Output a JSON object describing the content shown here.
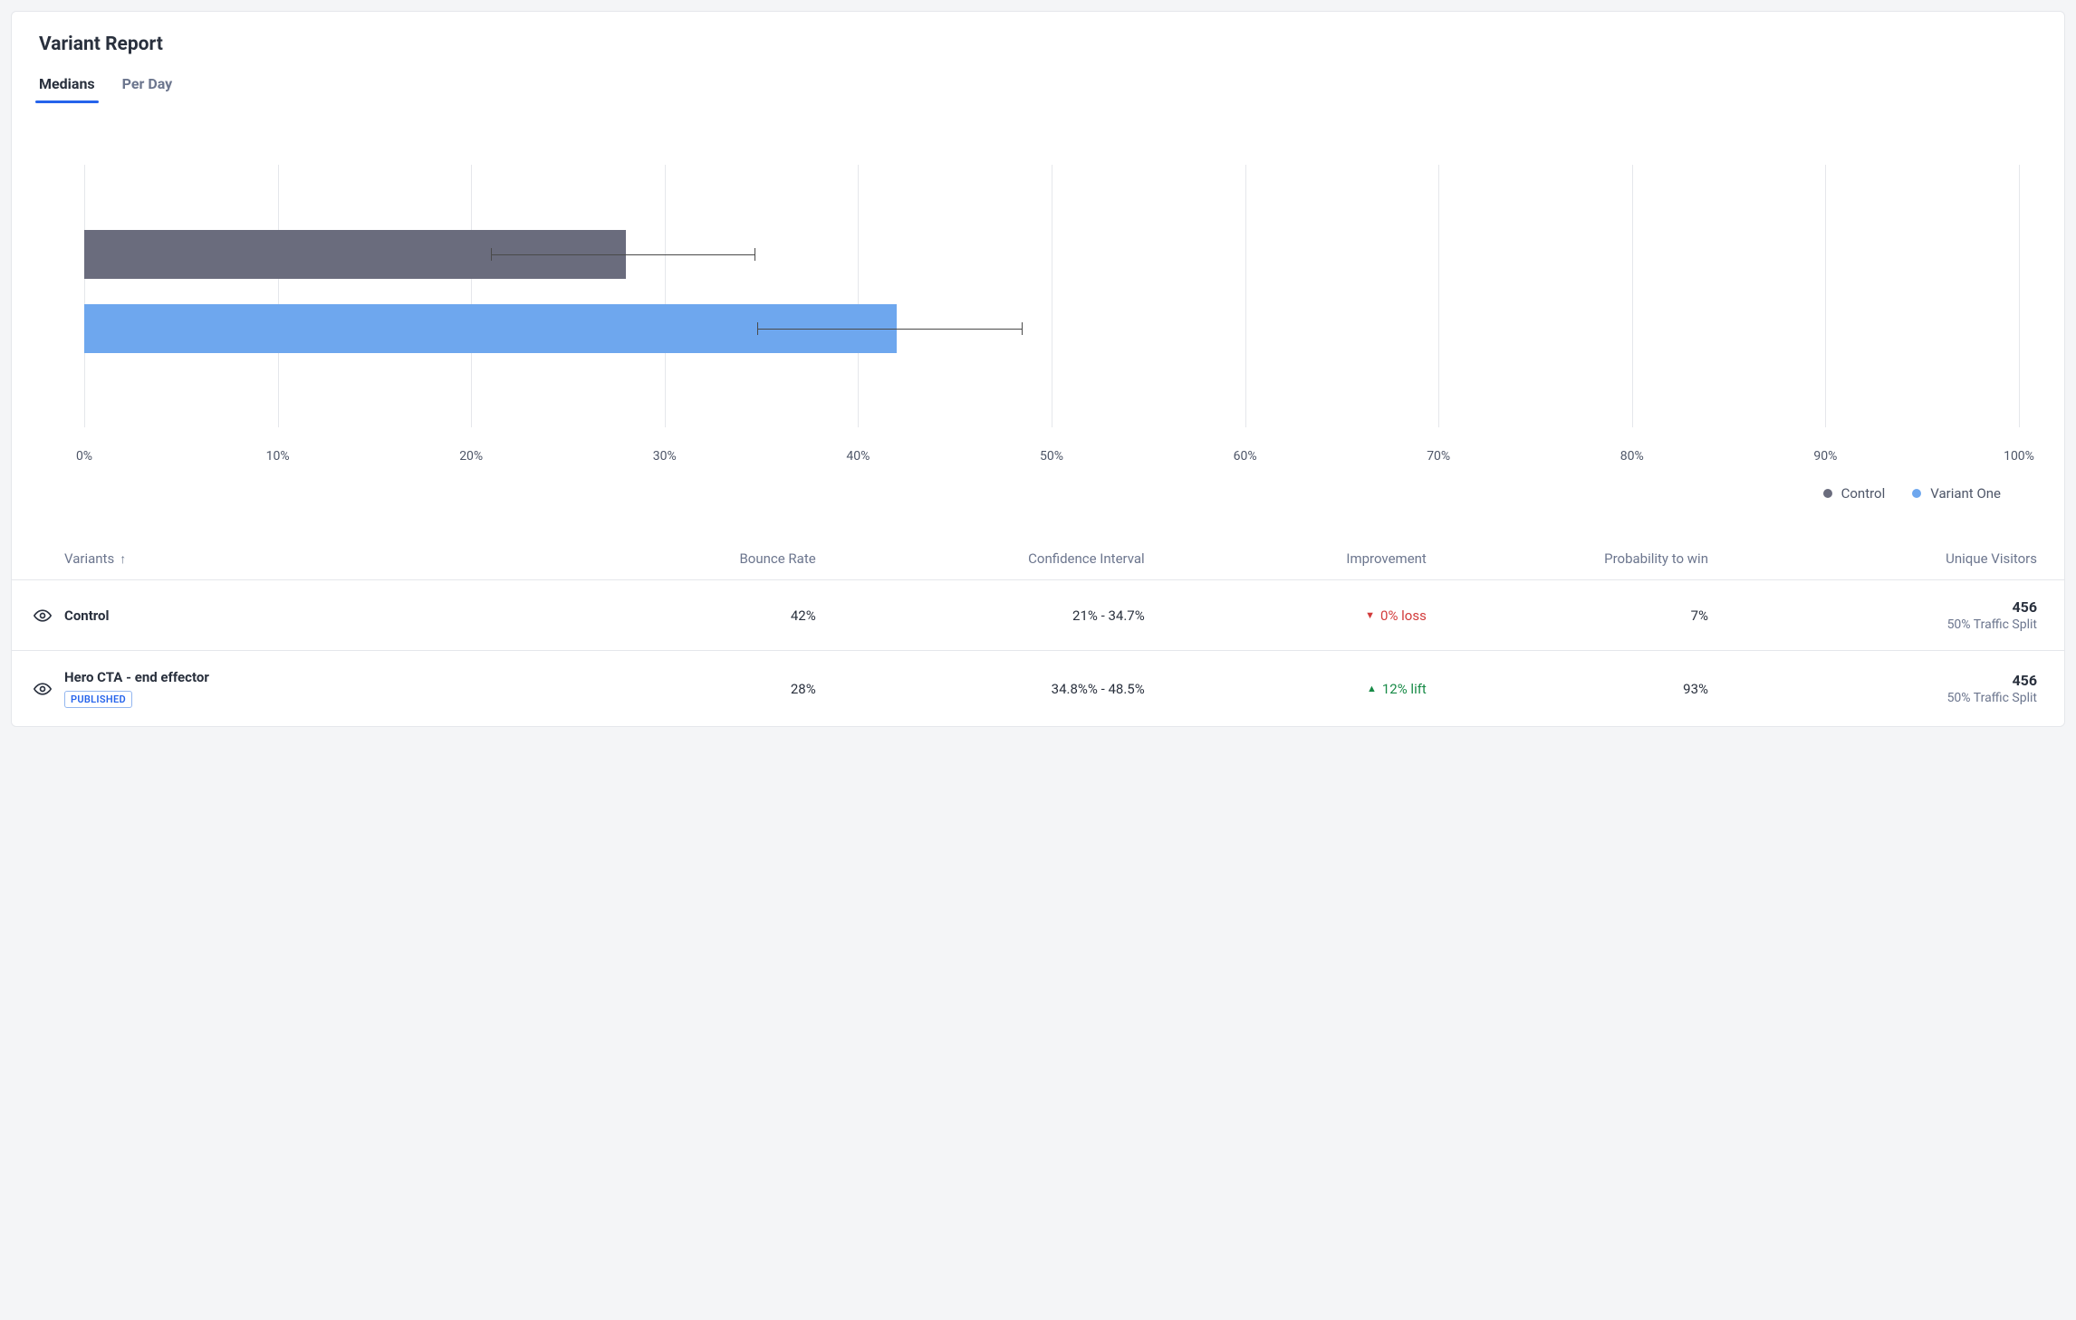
{
  "title": "Variant Report",
  "tabs": {
    "medians": "Medians",
    "per_day": "Per Day",
    "active": "medians"
  },
  "chart_data": {
    "type": "bar",
    "orientation": "horizontal",
    "xlabel": "",
    "ylabel": "",
    "xlim": [
      0,
      100
    ],
    "x_unit": "%",
    "ticks": [
      "0%",
      "10%",
      "20%",
      "30%",
      "40%",
      "50%",
      "60%",
      "70%",
      "80%",
      "90%",
      "100%"
    ],
    "series": [
      {
        "name": "Control",
        "color": "#6a6c7d",
        "value": 28,
        "error_low": 21.0,
        "error_high": 34.7
      },
      {
        "name": "Variant One",
        "color": "#6ea7ee",
        "value": 42,
        "error_low": 34.8,
        "error_high": 48.5
      }
    ],
    "legend_position": "bottom-right"
  },
  "legend": {
    "control": "Control",
    "variant": "Variant One"
  },
  "table": {
    "columns": {
      "variants": "Variants",
      "bounce": "Bounce Rate",
      "ci": "Confidence Interval",
      "improvement": "Improvement",
      "prob": "Probability to win",
      "visitors": "Unique Visitors"
    },
    "rows": [
      {
        "name": "Control",
        "badge": "",
        "bounce": "42%",
        "ci": "21%  - 34.7%",
        "improvement_dir": "loss",
        "improvement": "0% loss",
        "prob": "7%",
        "visitors": "456",
        "split": "50% Traffic Split"
      },
      {
        "name": "Hero CTA - end effector",
        "badge": "PUBLISHED",
        "bounce": "28%",
        "ci": "34.8%%  - 48.5%",
        "improvement_dir": "lift",
        "improvement": "12% lift",
        "prob": "93%",
        "visitors": "456",
        "split": "50% Traffic Split"
      }
    ]
  }
}
